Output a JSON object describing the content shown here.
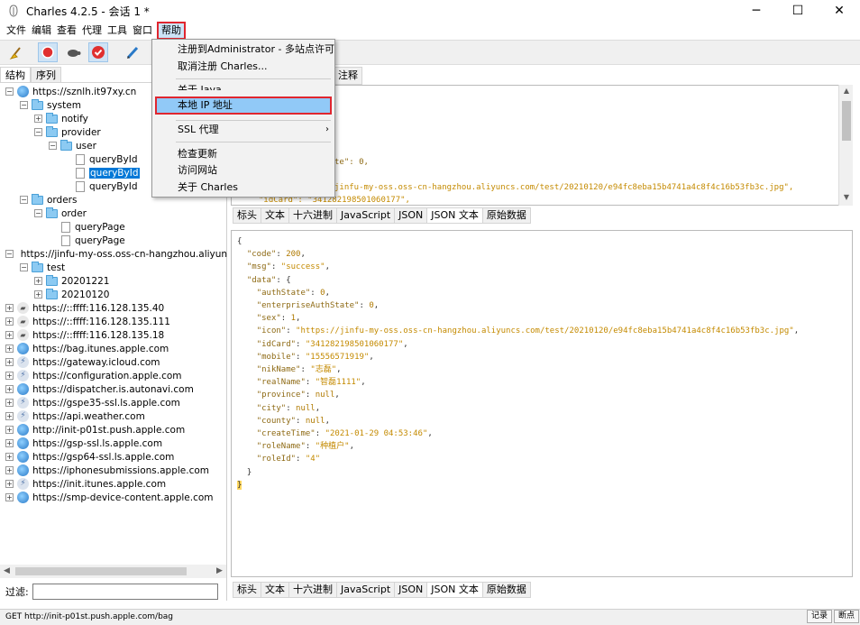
{
  "window": {
    "title": "Charles 4.2.5 - 会话 1 *",
    "min": "─",
    "max": "☐",
    "close": "✕"
  },
  "menubar": [
    "文件",
    "编辑",
    "查看",
    "代理",
    "工具",
    "窗口",
    "帮助"
  ],
  "help_menu": {
    "register": "注册到Administrator - 多站点许可",
    "unregister": "取消注册 Charles...",
    "about_java": "关于 Java",
    "local_ip": "本地 IP 地址",
    "ssl_proxy": "SSL 代理",
    "check_updates": "检查更新",
    "visit_website": "访问网站",
    "about_charles": "关于 Charles"
  },
  "left_tabs": [
    "结构",
    "序列"
  ],
  "tree": [
    {
      "label": "https://sznlh.it97xy.cn",
      "icon": "globe"
    },
    {
      "label": "system",
      "icon": "folder"
    },
    {
      "label": "notify",
      "icon": "folder"
    },
    {
      "label": "provider",
      "icon": "folder"
    },
    {
      "label": "user",
      "icon": "folder"
    },
    {
      "label": "queryById",
      "icon": "doc"
    },
    {
      "label": "queryById",
      "icon": "doc"
    },
    {
      "label": "queryById",
      "icon": "doc"
    },
    {
      "label": "orders",
      "icon": "folder"
    },
    {
      "label": "order",
      "icon": "folder"
    },
    {
      "label": "queryPage",
      "icon": "doc"
    },
    {
      "label": "queryPage",
      "icon": "doc"
    },
    {
      "label": "https://jinfu-my-oss.oss-cn-hangzhou.aliyun",
      "icon": "globe"
    },
    {
      "label": "test",
      "icon": "folder"
    },
    {
      "label": "20201221",
      "icon": "folder"
    },
    {
      "label": "20210120",
      "icon": "folder"
    },
    {
      "label": "https://::ffff:116.128.135.40",
      "icon": "lock"
    },
    {
      "label": "https://::ffff:116.128.135.111",
      "icon": "lock"
    },
    {
      "label": "https://::ffff:116.128.135.18",
      "icon": "lock"
    },
    {
      "label": "https://bag.itunes.apple.com",
      "icon": "globe"
    },
    {
      "label": "https://gateway.icloud.com",
      "icon": "bolt"
    },
    {
      "label": "https://configuration.apple.com",
      "icon": "bolt"
    },
    {
      "label": "https://dispatcher.is.autonavi.com",
      "icon": "globe"
    },
    {
      "label": "https://gspe35-ssl.ls.apple.com",
      "icon": "bolt"
    },
    {
      "label": "https://api.weather.com",
      "icon": "bolt"
    },
    {
      "label": "http://init-p01st.push.apple.com",
      "icon": "globe"
    },
    {
      "label": "https://gsp-ssl.ls.apple.com",
      "icon": "globe"
    },
    {
      "label": "https://gsp64-ssl.ls.apple.com",
      "icon": "globe"
    },
    {
      "label": "https://iphonesubmissions.apple.com",
      "icon": "globe"
    },
    {
      "label": "https://init.itunes.apple.com",
      "icon": "bolt"
    },
    {
      "label": "https://smp-device-content.apple.com",
      "icon": "globe"
    }
  ],
  "filter_label": "过滤:",
  "filter_value": "",
  "right_top_tab_partial": "注释",
  "upper_fragments": {
    "line1": "te\": 0,",
    "line2": "jinfu-my-oss.oss-cn-hangzhou.aliyuncs.com/test/20210120/e94fc8eba15b4741a4c8f4c16b53fb3c.jpg\",",
    "line3": "\"idCard\": \"341282198501060177\","
  },
  "view_tabs": [
    "标头",
    "文本",
    "十六进制",
    "JavaScript",
    "JSON",
    "JSON 文本",
    "原始数据"
  ],
  "response_json": {
    "code": "200",
    "msg": "\"success\"",
    "authState": "0",
    "enterpriseAuthState": "0",
    "sex": "1",
    "icon": "\"https://jinfu-my-oss.oss-cn-hangzhou.aliyuncs.com/test/20210120/e94fc8eba15b4741a4c8f4c16b53fb3c.jpg\"",
    "idCard": "\"341282198501060177\"",
    "mobile": "\"15556571919\"",
    "nikName": "\"志磊\"",
    "realName": "\"智磊1111\"",
    "province": "null",
    "city": "null",
    "county": "null",
    "createTime": "\"2021-01-29 04:53:46\"",
    "roleName": "\"种植户\"",
    "roleId": "\"4\""
  },
  "status": {
    "text": "GET http://init-p01st.push.apple.com/bag",
    "record": "记录",
    "breakpoints": "断点"
  }
}
